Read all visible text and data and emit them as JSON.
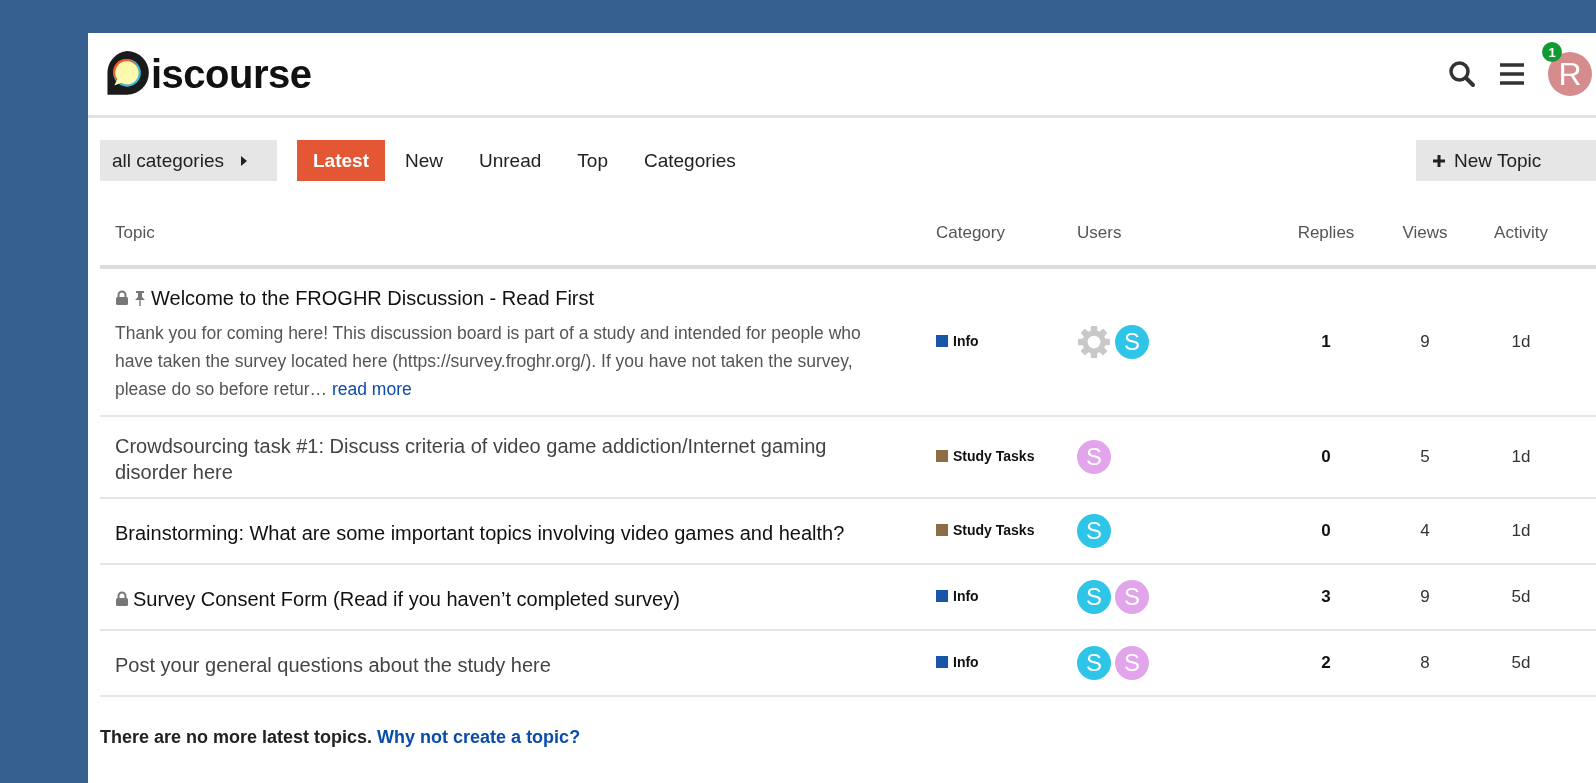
{
  "header": {
    "logo_text": "iscourse",
    "notification_count": "1",
    "avatar_letter": "R"
  },
  "nav": {
    "category_filter": "all categories",
    "tabs": [
      {
        "label": "Latest",
        "selected": true
      },
      {
        "label": "New",
        "selected": false
      },
      {
        "label": "Unread",
        "selected": false
      },
      {
        "label": "Top",
        "selected": false
      },
      {
        "label": "Categories",
        "selected": false
      }
    ],
    "new_topic_button": "New Topic"
  },
  "table": {
    "columns": [
      "Topic",
      "Category",
      "Users",
      "Replies",
      "Views",
      "Activity"
    ],
    "rows": [
      {
        "title": "Welcome to the FROGHR Discussion - Read First",
        "locked": true,
        "pinned": true,
        "visited": false,
        "excerpt": "Thank you for coming here! This discussion board is part of a study and intended for people who have taken the survey located here (https://survey.froghr.org/). If you have not taken the survey, please do so before retur…",
        "read_more": "read more",
        "category": {
          "name": "Info",
          "color": "#1a56a8"
        },
        "users": [
          {
            "kind": "system"
          },
          {
            "kind": "letter",
            "letter": "S",
            "color": "#2ec5e8"
          }
        ],
        "replies": "1",
        "views": "9",
        "activity": "1d"
      },
      {
        "title": "Crowdsourcing task #1: Discuss criteria of video game addiction/Internet gaming disorder here",
        "locked": false,
        "pinned": false,
        "visited": true,
        "category": {
          "name": "Study Tasks",
          "color": "#8c6d46"
        },
        "users": [
          {
            "kind": "letter",
            "letter": "S",
            "color": "#e2a4ea"
          }
        ],
        "replies": "0",
        "views": "5",
        "activity": "1d"
      },
      {
        "title": "Brainstorming: What are some important topics involving video games and health?",
        "locked": false,
        "pinned": false,
        "visited": false,
        "category": {
          "name": "Study Tasks",
          "color": "#8c6d46"
        },
        "users": [
          {
            "kind": "letter",
            "letter": "S",
            "color": "#2ec5e8"
          }
        ],
        "replies": "0",
        "views": "4",
        "activity": "1d"
      },
      {
        "title": "Survey Consent Form (Read if you haven’t completed survey)",
        "locked": true,
        "pinned": false,
        "visited": false,
        "category": {
          "name": "Info",
          "color": "#1a56a8"
        },
        "users": [
          {
            "kind": "letter",
            "letter": "S",
            "color": "#2ec5e8"
          },
          {
            "kind": "letter",
            "letter": "S",
            "color": "#e2a4ea"
          }
        ],
        "replies": "3",
        "views": "9",
        "activity": "5d"
      },
      {
        "title": "Post your general questions about the study here",
        "locked": false,
        "pinned": false,
        "visited": true,
        "category": {
          "name": "Info",
          "color": "#1a56a8"
        },
        "users": [
          {
            "kind": "letter",
            "letter": "S",
            "color": "#2ec5e8"
          },
          {
            "kind": "letter",
            "letter": "S",
            "color": "#e2a4ea"
          }
        ],
        "replies": "2",
        "views": "8",
        "activity": "5d"
      }
    ]
  },
  "footer": {
    "message": "There are no more latest topics.",
    "link": "Why not create a topic?"
  }
}
